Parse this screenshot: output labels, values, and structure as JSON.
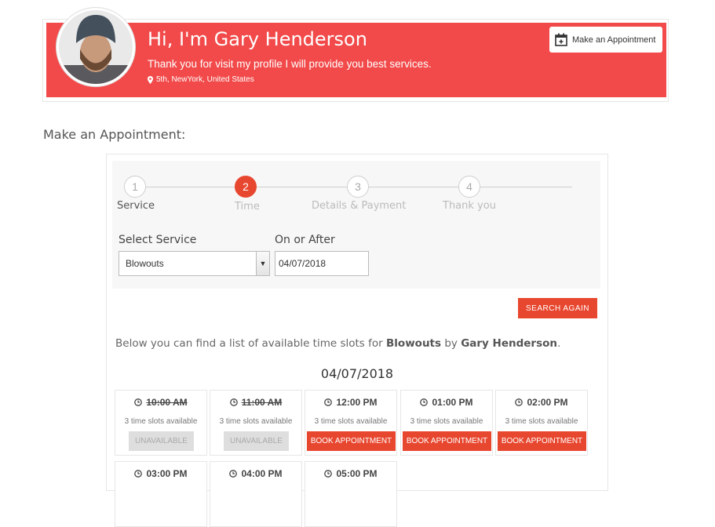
{
  "profile": {
    "name": "Hi, I'm Gary Henderson",
    "description": "Thank you for visit my profile I will provide you best services.",
    "location": "5th, NewYork, United States",
    "appointment_button": "Make an Appointment"
  },
  "section_title": "Make an Appointment:",
  "steps": [
    {
      "number": "1",
      "label": "Service"
    },
    {
      "number": "2",
      "label": "Time"
    },
    {
      "number": "3",
      "label": "Details & Payment"
    },
    {
      "number": "4",
      "label": "Thank you"
    }
  ],
  "form": {
    "service_label": "Select Service",
    "service_value": "Blowouts",
    "date_label": "On or After",
    "date_value": "04/07/2018",
    "search_button": "SEARCH AGAIN"
  },
  "info": {
    "prefix": "Below you can find a list of available time slots for ",
    "service": "Blowouts",
    "middle": " by ",
    "provider": "Gary Henderson",
    "suffix": "."
  },
  "slots_date": "04/07/2018",
  "slots": [
    {
      "time": "10:00 AM",
      "availability": "3 time slots available",
      "button": "UNAVAILABLE"
    },
    {
      "time": "11:00 AM",
      "availability": "3 time slots available",
      "button": "UNAVAILABLE"
    },
    {
      "time": "12:00 PM",
      "availability": "3 time slots available",
      "button": "BOOK APPOINTMENT"
    },
    {
      "time": "01:00 PM",
      "availability": "3 time slots available",
      "button": "BOOK APPOINTMENT"
    },
    {
      "time": "02:00 PM",
      "availability": "3 time slots available",
      "button": "BOOK APPOINTMENT"
    },
    {
      "time": "03:00 PM"
    },
    {
      "time": "04:00 PM"
    },
    {
      "time": "05:00 PM"
    }
  ],
  "colors": {
    "banner": "#f24a4a",
    "accent": "#e8472f",
    "unavailable": "#dedede"
  }
}
